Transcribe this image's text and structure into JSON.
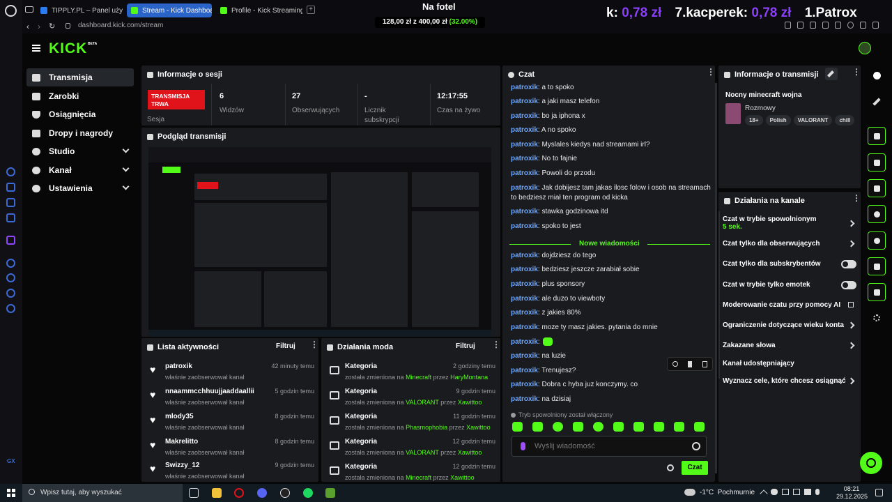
{
  "browser": {
    "tabs": [
      {
        "label": "TIPPLY.PL – Panel użytkow"
      },
      {
        "label": "Stream - Kick Dashboard"
      },
      {
        "label": "Profile - Kick Streaming"
      }
    ],
    "url": "dashboard.kick.com/stream"
  },
  "overlay": {
    "goal_title": "Na fotel",
    "goal_current": "128,00 zł",
    "goal_sep": "z",
    "goal_target": "400,00 zł",
    "goal_percent": "(32.00%)",
    "ticker": [
      {
        "name": "k:",
        "amount": "0,78 zł"
      },
      {
        "name": "7.kacperek:",
        "amount": "0,78 zł"
      },
      {
        "name": "1.Patrox",
        "amount": ""
      }
    ]
  },
  "header": {
    "logo": "KICK",
    "beta": "BETA"
  },
  "sidebar": {
    "items": [
      {
        "label": "Transmisja"
      },
      {
        "label": "Zarobki"
      },
      {
        "label": "Osiągnięcia"
      },
      {
        "label": "Dropy i nagrody"
      },
      {
        "label": "Studio"
      },
      {
        "label": "Kanał"
      },
      {
        "label": "Ustawienia"
      }
    ]
  },
  "session": {
    "title": "Informacje o sesji",
    "live_badge": "TRANSMISJA TRWA",
    "session_label": "Sesja",
    "stats": [
      {
        "value": "6",
        "label": "Widzów"
      },
      {
        "value": "27",
        "label": "Obserwujących"
      },
      {
        "value": "-",
        "label": "Licznik subskrypcji"
      },
      {
        "value": "12:17:55",
        "label": "Czas na żywo"
      }
    ]
  },
  "preview": {
    "title": "Podgląd transmisji"
  },
  "activity": {
    "title": "Lista aktywności",
    "filter": "Filtruj",
    "items": [
      {
        "name": "patroxik",
        "sub": "właśnie zaobserwował kanał",
        "time": "42 minuty temu"
      },
      {
        "name": "nnaammcchhuujjaaddaallii",
        "sub": "właśnie zaobserwował kanał",
        "time": "5 godzin temu"
      },
      {
        "name": "mlody35",
        "sub": "właśnie zaobserwował kanał",
        "time": "8 godzin temu"
      },
      {
        "name": "Makrelitto",
        "sub": "właśnie zaobserwował kanał",
        "time": "8 godzin temu"
      },
      {
        "name": "Swizzy_12",
        "sub": "właśnie zaobserwował kanał",
        "time": "9 godzin temu"
      }
    ]
  },
  "modactions": {
    "title": "Działania moda",
    "filter": "Filtruj",
    "items": [
      {
        "name": "Kategoria",
        "pre": "została zmieniona na",
        "cat": "Minecraft",
        "by": "przez",
        "who": "HaryMontana",
        "time": "2 godziny temu"
      },
      {
        "name": "Kategoria",
        "pre": "została zmieniona na",
        "cat": "VALORANT",
        "by": "przez",
        "who": "Xawittoo",
        "time": "9 godzin temu"
      },
      {
        "name": "Kategoria",
        "pre": "została zmieniona na",
        "cat": "Phasmophobia",
        "by": "przez",
        "who": "Xawittoo",
        "time": "11 godzin temu"
      },
      {
        "name": "Kategoria",
        "pre": "została zmieniona na",
        "cat": "VALORANT",
        "by": "przez",
        "who": "Xawittoo",
        "time": "12 godzin temu"
      },
      {
        "name": "Kategoria",
        "pre": "została zmieniona na",
        "cat": "Minecraft",
        "by": "przez",
        "who": "Xawittoo",
        "time": "12 godzin temu"
      }
    ]
  },
  "chat": {
    "title": "Czat",
    "messages_before": [
      {
        "user": "patroxik",
        "text": ": a to spoko"
      },
      {
        "user": "patroxik",
        "text": ": a jaki masz telefon"
      },
      {
        "user": "patroxik",
        "text": ": bo ja iphona x"
      },
      {
        "user": "patroxik",
        "text": ": A no spoko"
      },
      {
        "user": "patroxik",
        "text": ": Myslales kiedys nad streamami irl?"
      },
      {
        "user": "patroxik",
        "text": ": No to fajnie"
      },
      {
        "user": "patroxik",
        "text": ": Powoli do przodu"
      },
      {
        "user": "patroxik",
        "text": ": Jak dobijesz tam jakas ilosc folow i osob na streamach to bedziesz miał ten program od kicka"
      },
      {
        "user": "patroxik",
        "text": ": stawka godzinowa itd"
      },
      {
        "user": "patroxik",
        "text": ": spoko to jest"
      }
    ],
    "new_divider": "Nowe wiadomości",
    "messages_after": [
      {
        "user": "patroxik",
        "text": ": dojdziesz do tego"
      },
      {
        "user": "patroxik",
        "text": ": bedziesz jeszcze zarabiał sobie"
      },
      {
        "user": "patroxik",
        "text": ": plus sponsory"
      },
      {
        "user": "patroxik",
        "text": ": ale duzo to viewboty"
      },
      {
        "user": "patroxik",
        "text": ": z jakies 80%"
      },
      {
        "user": "patroxik",
        "text": ": moze ty masz jakies. pytania do mnie"
      },
      {
        "user": "patroxik",
        "text": ":"
      },
      {
        "user": "patroxik",
        "text": ": na luzie"
      },
      {
        "user": "patroxik",
        "text": ": Trenujesz?"
      },
      {
        "user": "patroxik",
        "text": ": Dobra c hyba juz konczymy. co"
      },
      {
        "user": "patroxik",
        "text": ": na dzisiaj"
      }
    ],
    "slow_mode_notice": "Tryb spowolniony został włączony",
    "input_placeholder": "Wyślij wiadomość",
    "send_label": "Czat"
  },
  "stream_info": {
    "title": "Informacje o transmisji",
    "stream_title": "Nocny minecraft wojna",
    "category": "Rozmowy",
    "tags": [
      "18+",
      "Polish",
      "VALORANT",
      "chill"
    ]
  },
  "channel_actions": {
    "title": "Działania na kanale",
    "items": [
      {
        "label": "Czat w trybie spowolnionym",
        "sub": "5 sek.",
        "control": "chevron"
      },
      {
        "label": "Czat tylko dla obserwujących",
        "control": "chevron"
      },
      {
        "label": "Czat tylko dla subskrybentów",
        "control": "toggle"
      },
      {
        "label": "Czat w trybie tylko emotek",
        "control": "toggle"
      },
      {
        "label": "Moderowanie czatu przy pomocy AI",
        "control": "external"
      },
      {
        "label": "Ograniczenie dotyczące wieku konta",
        "control": "chevron"
      },
      {
        "label": "Zakazane słowa",
        "control": "chevron"
      },
      {
        "label": "Kanał udostępniający",
        "control": "none"
      },
      {
        "label": "Wyznacz cele, które chcesz osiągnąć",
        "control": "chevron"
      }
    ]
  },
  "taskbar": {
    "search_placeholder": "Wpisz tutaj, aby wyszukać",
    "weather": "-1°C  Pochmurnie",
    "time": "08:21",
    "date": "29.12.2025"
  },
  "colors": {
    "accent": "#53fc18",
    "live": "#e0131b",
    "username": "#6fa8ff",
    "ticker": "#8a3ffc"
  }
}
